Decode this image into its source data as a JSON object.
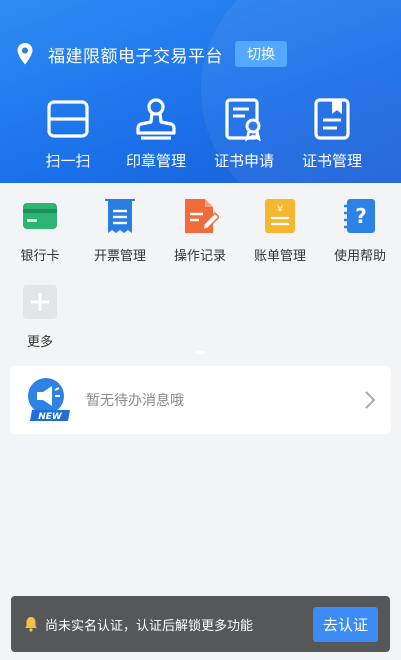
{
  "header": {
    "location_title": "福建限额电子交易平台",
    "switch_label": "切换",
    "actions": [
      {
        "label": "扫一扫",
        "icon": "scan-icon"
      },
      {
        "label": "印章管理",
        "icon": "seal-icon"
      },
      {
        "label": "证书申请",
        "icon": "certificate-apply-icon"
      },
      {
        "label": "证书管理",
        "icon": "certificate-manage-icon"
      }
    ]
  },
  "grid": {
    "items": [
      {
        "label": "银行卡",
        "icon": "bank-card-icon"
      },
      {
        "label": "开票管理",
        "icon": "invoice-icon"
      },
      {
        "label": "操作记录",
        "icon": "operation-record-icon"
      },
      {
        "label": "账单管理",
        "icon": "bill-icon"
      },
      {
        "label": "使用帮助",
        "icon": "help-icon"
      },
      {
        "label": "更多",
        "icon": "plus-icon"
      }
    ]
  },
  "message": {
    "text": "暂无待办消息哦",
    "badge": "NEW"
  },
  "verify_bar": {
    "text": "尚未实名认证，认证后解锁更多功能",
    "button_label": "去认证"
  },
  "colors": {
    "header_blue": "#1a6fe8",
    "switch_blue": "#4aa3ff",
    "bank_green": "#2bb673",
    "invoice_blue": "#2a7de1",
    "record_orange": "#f26b3a",
    "bill_yellow": "#f5b72f",
    "help_blue": "#2d82e6",
    "verify_button": "#3d8bf5"
  }
}
